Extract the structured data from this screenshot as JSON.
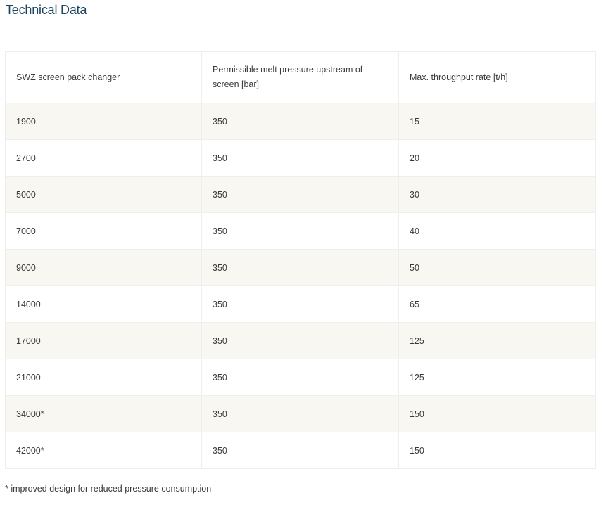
{
  "page": {
    "title": "Technical Data",
    "footnote": "* improved design for reduced pressure consumption"
  },
  "table": {
    "headers": [
      "SWZ screen pack changer",
      "Permissible melt pressure upstream of screen [bar]",
      "Max. throughput rate [t/h]"
    ],
    "rows": [
      [
        "1900",
        "350",
        "15"
      ],
      [
        "2700",
        "350",
        "20"
      ],
      [
        "5000",
        "350",
        "30"
      ],
      [
        "7000",
        "350",
        "40"
      ],
      [
        "9000",
        "350",
        "50"
      ],
      [
        "14000",
        "350",
        "65"
      ],
      [
        "17000",
        "350",
        "125"
      ],
      [
        "21000",
        "350",
        "125"
      ],
      [
        "34000*",
        "350",
        "150"
      ],
      [
        "42000*",
        "350",
        "150"
      ]
    ]
  }
}
